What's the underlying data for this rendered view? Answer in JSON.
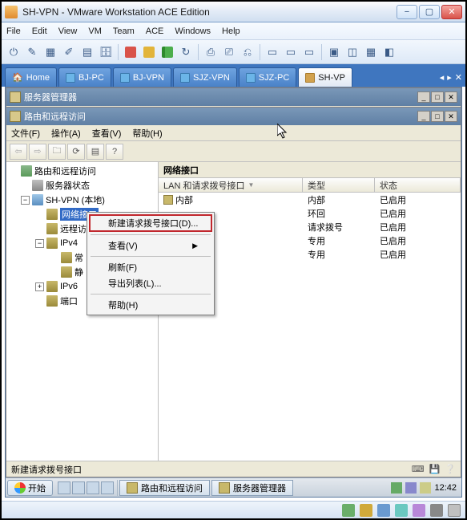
{
  "vmware": {
    "title": "SH-VPN - VMware Workstation ACE Edition",
    "menus": [
      "File",
      "Edit",
      "View",
      "VM",
      "Team",
      "ACE",
      "Windows",
      "Help"
    ],
    "tabs": [
      {
        "label": "Home"
      },
      {
        "label": "BJ-PC"
      },
      {
        "label": "BJ-VPN"
      },
      {
        "label": "SJZ-VPN"
      },
      {
        "label": "SJZ-PC"
      },
      {
        "label": "SH-VP",
        "active": true
      }
    ]
  },
  "srvmgr": {
    "title": "服务器管理器"
  },
  "rras": {
    "title": "路由和远程访问",
    "menus": [
      "文件(F)",
      "操作(A)",
      "查看(V)",
      "帮助(H)"
    ],
    "tree": {
      "root": "路由和远程访问",
      "status": "服务器状态",
      "server": "SH-VPN (本地)",
      "netif": "网络接口",
      "remote": "远程访",
      "ipv4": "IPv4",
      "ipv4_child1": "常",
      "ipv4_child2": "静",
      "ipv6": "IPv6",
      "ports": "端口"
    },
    "list": {
      "title": "网络接口",
      "headers": [
        "LAN 和请求拨号接口",
        "类型",
        "状态"
      ],
      "rows": [
        {
          "name": "内部",
          "type": "内部",
          "status": "已启用"
        },
        {
          "name": "",
          "type": "环回",
          "status": "已启用"
        },
        {
          "name": "",
          "type": "请求拨号",
          "status": "已启用"
        },
        {
          "name": "",
          "type": "专用",
          "status": "已启用"
        },
        {
          "name": "",
          "type": "专用",
          "status": "已启用"
        }
      ]
    },
    "context": {
      "new_dial": "新建请求拨号接口(D)...",
      "view": "查看(V)",
      "refresh": "刷新(F)",
      "export": "导出列表(L)...",
      "help": "帮助(H)"
    },
    "statusbar": "新建请求拨号接口"
  },
  "taskbar": {
    "start": "开始",
    "tasks": [
      "路由和远程访问",
      "服务器管理器"
    ],
    "clock": "12:42"
  }
}
